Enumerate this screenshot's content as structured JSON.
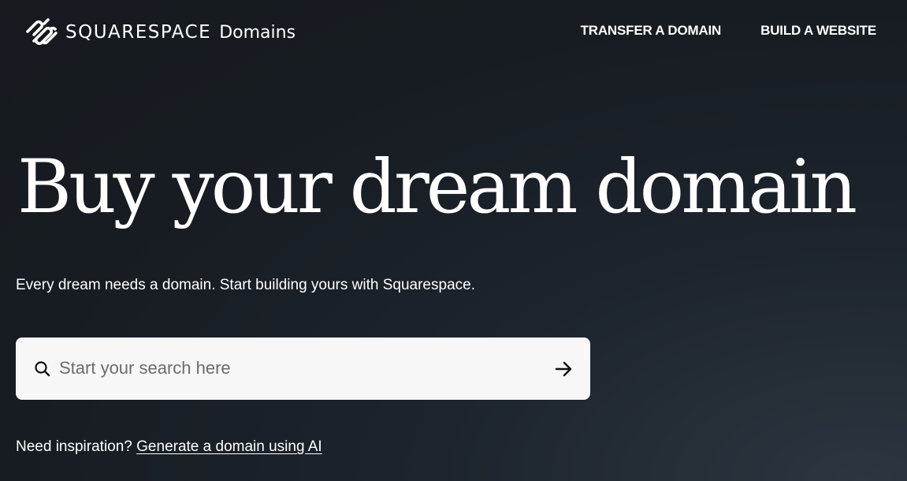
{
  "header": {
    "logo": {
      "icon": "squarespace-logo-icon",
      "wordmark": "SQUARESPACE",
      "product": "Domains"
    },
    "nav": [
      {
        "label": "TRANSFER A DOMAIN"
      },
      {
        "label": "BUILD A WEBSITE"
      }
    ]
  },
  "hero": {
    "title": "Buy your dream domain",
    "subtitle": "Every dream needs a domain. Start building yours with Squarespace."
  },
  "search": {
    "icon": "search-icon",
    "placeholder": "Start your search here",
    "value": "",
    "submit_icon": "arrow-right-icon"
  },
  "inspiration": {
    "prompt": "Need inspiration?",
    "link": "Generate a domain using AI"
  },
  "colors": {
    "background": "#171c22",
    "text": "#ffffff",
    "search_bg": "#f7f7f7",
    "placeholder": "#6b6b6b"
  }
}
